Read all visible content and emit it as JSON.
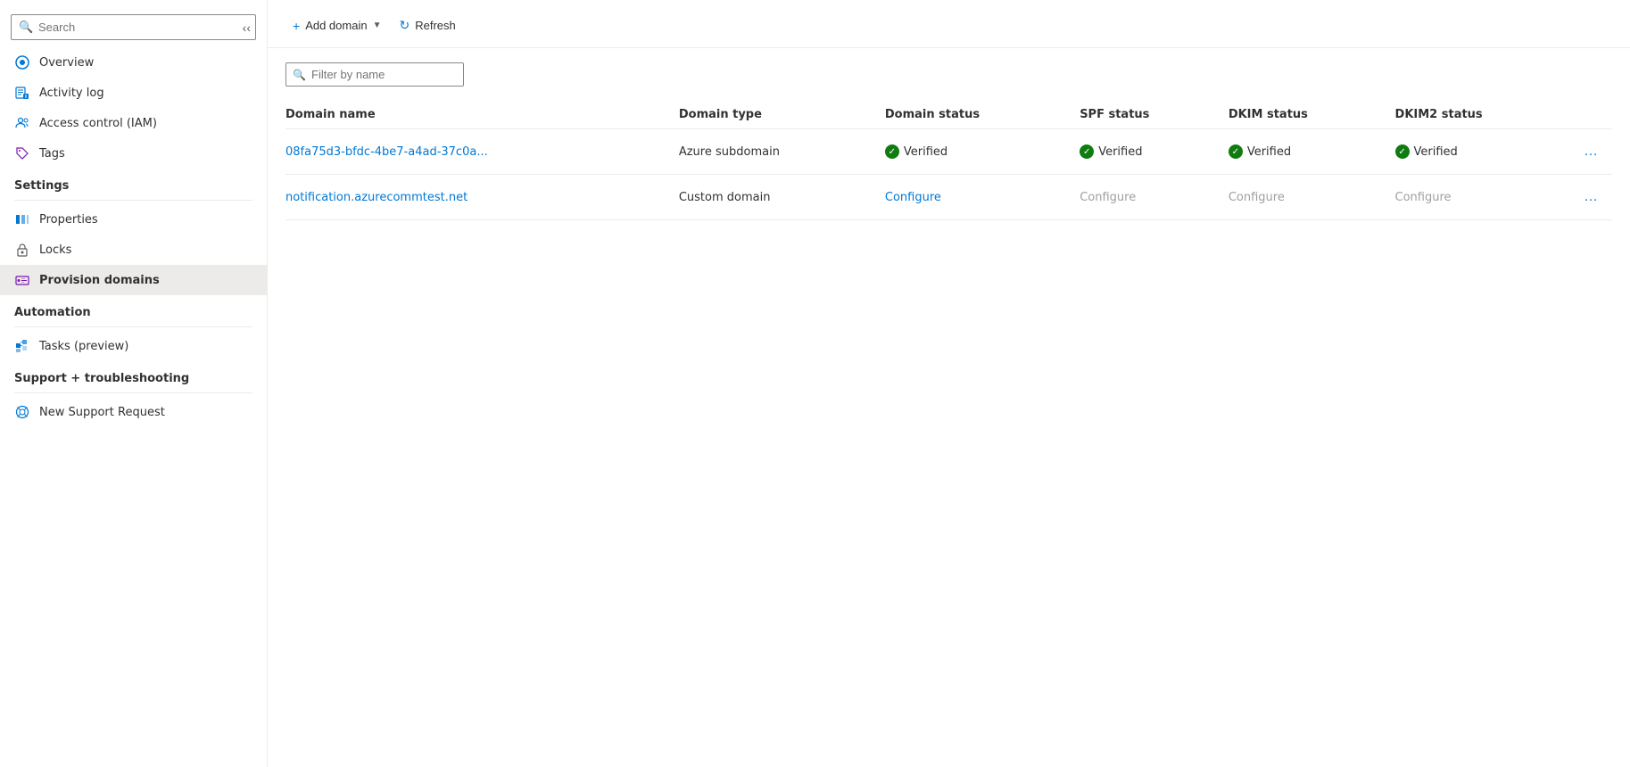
{
  "sidebar": {
    "search_placeholder": "Search",
    "items": {
      "overview": {
        "label": "Overview"
      },
      "activity_log": {
        "label": "Activity log"
      },
      "access_control": {
        "label": "Access control (IAM)"
      },
      "tags": {
        "label": "Tags"
      }
    },
    "sections": {
      "settings": {
        "header": "Settings",
        "items": {
          "properties": {
            "label": "Properties"
          },
          "locks": {
            "label": "Locks"
          },
          "provision_domains": {
            "label": "Provision domains"
          }
        }
      },
      "automation": {
        "header": "Automation",
        "items": {
          "tasks": {
            "label": "Tasks (preview)"
          }
        }
      },
      "support": {
        "header": "Support + troubleshooting",
        "items": {
          "new_support": {
            "label": "New Support Request"
          }
        }
      }
    }
  },
  "toolbar": {
    "add_domain_label": "Add domain",
    "refresh_label": "Refresh"
  },
  "filter": {
    "placeholder": "Filter by name"
  },
  "table": {
    "columns": {
      "domain_name": "Domain name",
      "domain_type": "Domain type",
      "domain_status": "Domain status",
      "spf_status": "SPF status",
      "dkim_status": "DKIM status",
      "dkim2_status": "DKIM2 status"
    },
    "rows": [
      {
        "domain_name": "08fa75d3-bfdc-4be7-a4ad-37c0a...",
        "domain_type": "Azure subdomain",
        "domain_status": "Verified",
        "spf_status": "Verified",
        "dkim_status": "Verified",
        "dkim2_status": "Verified",
        "is_verified_row": true
      },
      {
        "domain_name": "notification.azurecommtest.net",
        "domain_type": "Custom domain",
        "domain_status": "Configure",
        "spf_status": "Configure",
        "dkim_status": "Configure",
        "dkim2_status": "Configure",
        "is_verified_row": false
      }
    ]
  },
  "colors": {
    "accent": "#0078d4",
    "verified_green": "#107c10",
    "configure_blue": "#0078d4",
    "configure_gray": "#a19f9d"
  }
}
